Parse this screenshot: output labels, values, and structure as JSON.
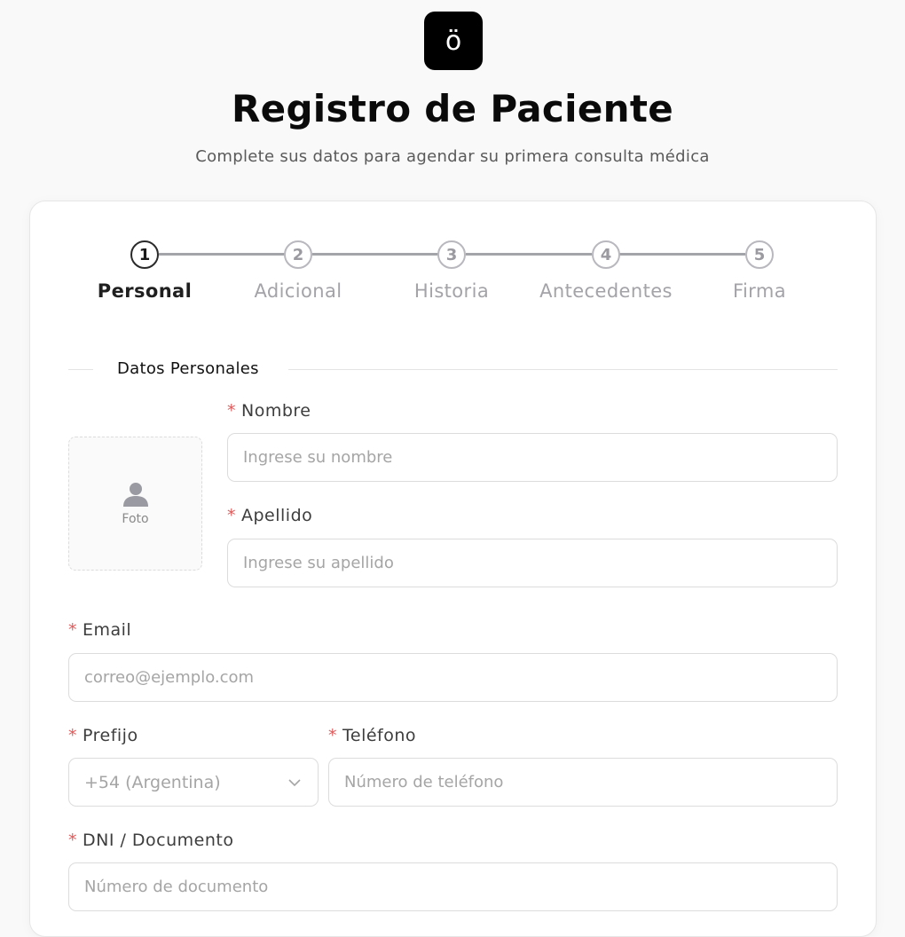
{
  "logo": {
    "glyph": "ö",
    "icon": "logo-icon"
  },
  "header": {
    "title": "Registro de Paciente",
    "subtitle": "Complete sus datos para agendar su primera consulta médica"
  },
  "stepper": {
    "steps": [
      {
        "number": "1",
        "label": "Personal",
        "active": true
      },
      {
        "number": "2",
        "label": "Adicional",
        "active": false
      },
      {
        "number": "3",
        "label": "Historia",
        "active": false
      },
      {
        "number": "4",
        "label": "Antecedentes",
        "active": false
      },
      {
        "number": "5",
        "label": "Firma",
        "active": false
      }
    ]
  },
  "section": {
    "title": "Datos Personales"
  },
  "photo": {
    "label": "Foto",
    "icon": "user-icon"
  },
  "form": {
    "required_mark": "*",
    "nombre": {
      "label": "Nombre",
      "placeholder": "Ingrese su nombre",
      "value": ""
    },
    "apellido": {
      "label": "Apellido",
      "placeholder": "Ingrese su apellido",
      "value": ""
    },
    "email": {
      "label": "Email",
      "placeholder": "correo@ejemplo.com",
      "value": ""
    },
    "prefijo": {
      "label": "Prefijo",
      "selected": "+54 (Argentina)",
      "icon": "chevron-down-icon"
    },
    "telefono": {
      "label": "Teléfono",
      "placeholder": "Número de teléfono",
      "value": ""
    },
    "dni": {
      "label": "DNI / Documento",
      "placeholder": "Número de documento",
      "value": ""
    }
  },
  "colors": {
    "required": "#e05a5a",
    "active_step": "#2a2a2a",
    "inactive_step": "#a3a3aa",
    "logo_bg": "#000000"
  }
}
